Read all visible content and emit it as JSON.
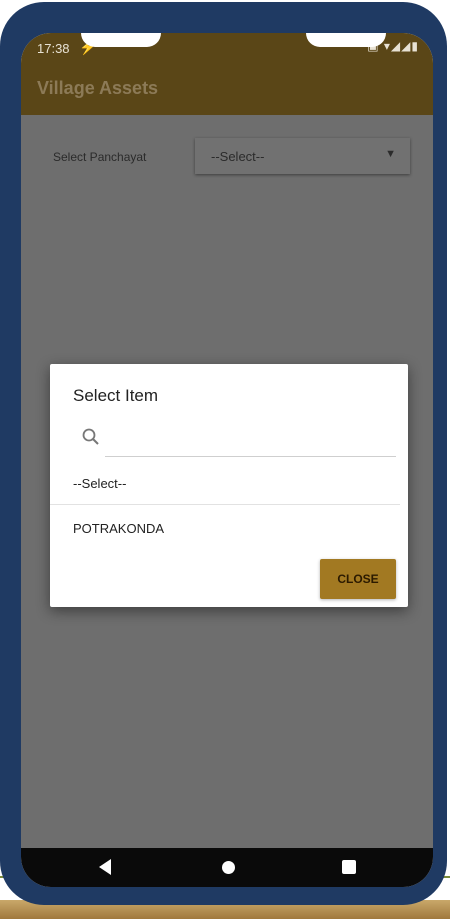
{
  "status_bar": {
    "time": "17:38",
    "notification_icon": "usb-icon",
    "status_icons": "▣ ▾◢◢▮"
  },
  "app_bar": {
    "title": "Village Assets"
  },
  "form": {
    "panchayat_label": "Select Panchayat",
    "panchayat_value": "--Select--"
  },
  "dialog": {
    "title": "Select Item",
    "search_placeholder": "",
    "items": [
      "--Select--",
      "POTRAKONDA"
    ],
    "close_label": "CLOSE"
  },
  "colors": {
    "app_bar": "#5a4617",
    "overlay": "#6e6e6e",
    "accent_button": "#a27922",
    "frame": "#1f3a63"
  }
}
